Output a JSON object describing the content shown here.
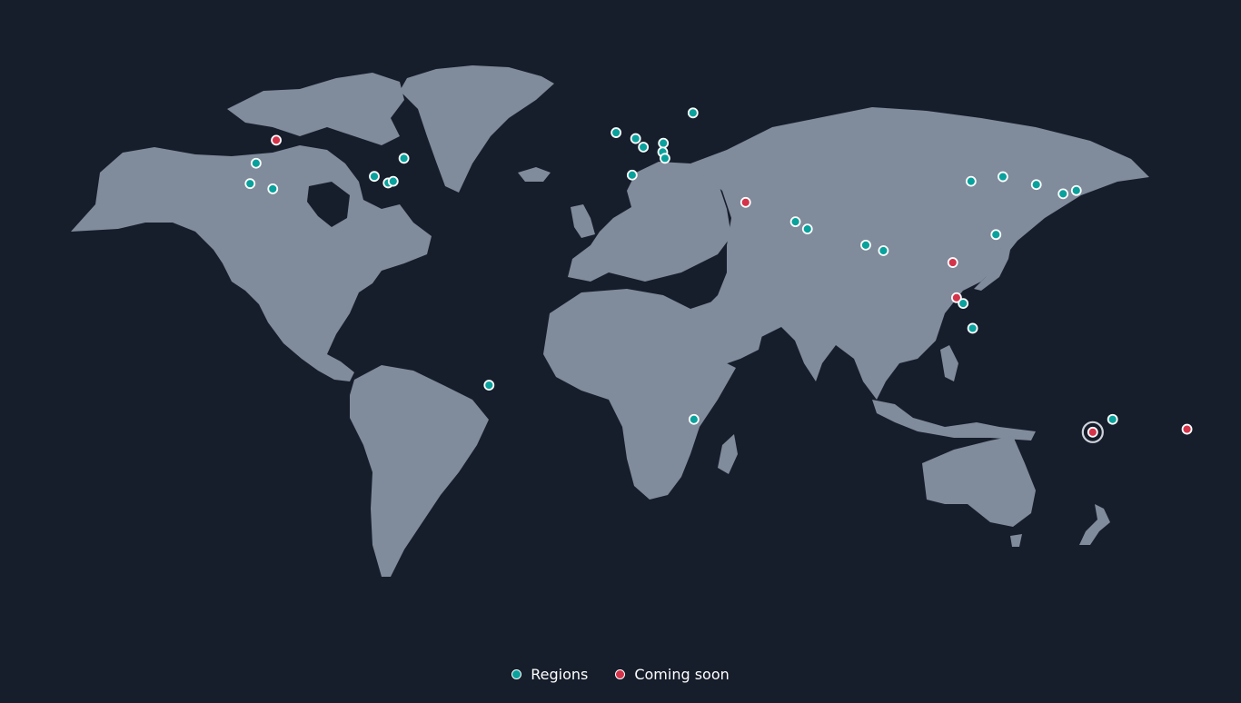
{
  "colors": {
    "background": "#161d2b",
    "land": "#808b9b",
    "region": "#0aa19c",
    "coming_soon": "#d4344a",
    "marker_stroke": "#ffffff",
    "legend_text": "#ffffff"
  },
  "legend": {
    "regions_label": "Regions",
    "coming_soon_label": "Coming soon"
  },
  "markers": [
    {
      "status": "coming_soon",
      "place": "Calgary",
      "lon": -114.1,
      "lat": 51.0
    },
    {
      "status": "region",
      "place": "Oregon",
      "lon": -120.5,
      "lat": 44.0
    },
    {
      "status": "region",
      "place": "N. California",
      "lon": -122.4,
      "lat": 37.8
    },
    {
      "status": "region",
      "place": "Las Vegas",
      "lon": -115.2,
      "lat": 36.2
    },
    {
      "status": "region",
      "place": "Montreal",
      "lon": -73.6,
      "lat": 45.5
    },
    {
      "status": "region",
      "place": "Ohio",
      "lon": -83.0,
      "lat": 40.0
    },
    {
      "status": "region",
      "place": "Virginia",
      "lon": -78.6,
      "lat": 38.0
    },
    {
      "status": "region",
      "place": "Washington DC",
      "lon": -77.0,
      "lat": 38.5
    },
    {
      "status": "region",
      "place": "Sao Paulo",
      "lon": -46.6,
      "lat": -23.5
    },
    {
      "status": "region",
      "place": "Ireland",
      "lon": -6.3,
      "lat": 53.3
    },
    {
      "status": "region",
      "place": "London",
      "lon": -0.1,
      "lat": 51.5
    },
    {
      "status": "region",
      "place": "Paris",
      "lon": 2.35,
      "lat": 48.9
    },
    {
      "status": "region",
      "place": "Frankfurt",
      "lon": 8.7,
      "lat": 50.1
    },
    {
      "status": "region",
      "place": "Zurich",
      "lon": 8.5,
      "lat": 47.4
    },
    {
      "status": "region",
      "place": "Milan",
      "lon": 9.2,
      "lat": 45.5
    },
    {
      "status": "region",
      "place": "Spain",
      "lon": -1.2,
      "lat": 40.4
    },
    {
      "status": "region",
      "place": "Stockholm",
      "lon": 18.1,
      "lat": 59.3
    },
    {
      "status": "coming_soon",
      "place": "Tel Aviv",
      "lon": 34.8,
      "lat": 32.1
    },
    {
      "status": "region",
      "place": "Bahrain",
      "lon": 50.6,
      "lat": 26.2
    },
    {
      "status": "region",
      "place": "UAE",
      "lon": 54.4,
      "lat": 24.0
    },
    {
      "status": "region",
      "place": "Cape Town",
      "lon": 18.4,
      "lat": -33.9
    },
    {
      "status": "region",
      "place": "Mumbai",
      "lon": 72.9,
      "lat": 19.1
    },
    {
      "status": "region",
      "place": "Hyderabad",
      "lon": 78.5,
      "lat": 17.4
    },
    {
      "status": "coming_soon",
      "place": "Bangkok",
      "lon": 100.5,
      "lat": 13.8
    },
    {
      "status": "coming_soon",
      "place": "Kuala Lumpur",
      "lon": 101.7,
      "lat": 3.1
    },
    {
      "status": "region",
      "place": "Singapore",
      "lon": 103.8,
      "lat": 1.35
    },
    {
      "status": "region",
      "place": "Jakarta",
      "lon": 106.8,
      "lat": -6.2
    },
    {
      "status": "region",
      "place": "Ningxia",
      "lon": 106.3,
      "lat": 38.5
    },
    {
      "status": "region",
      "place": "Beijing",
      "lon": 116.4,
      "lat": 39.9
    },
    {
      "status": "region",
      "place": "Hong Kong",
      "lon": 114.2,
      "lat": 22.3
    },
    {
      "status": "region",
      "place": "Seoul",
      "lon": 127.0,
      "lat": 37.5
    },
    {
      "status": "region",
      "place": "Osaka",
      "lon": 135.5,
      "lat": 34.7
    },
    {
      "status": "region",
      "place": "Tokyo",
      "lon": 139.7,
      "lat": 35.7
    },
    {
      "status": "region",
      "place": "Sydney",
      "lon": 151.2,
      "lat": -33.9
    },
    {
      "status": "coming_soon",
      "place": "Melbourne",
      "lon": 144.9,
      "lat": -37.8,
      "highlighted": true
    },
    {
      "status": "coming_soon",
      "place": "Auckland",
      "lon": 174.8,
      "lat": -36.9
    }
  ]
}
